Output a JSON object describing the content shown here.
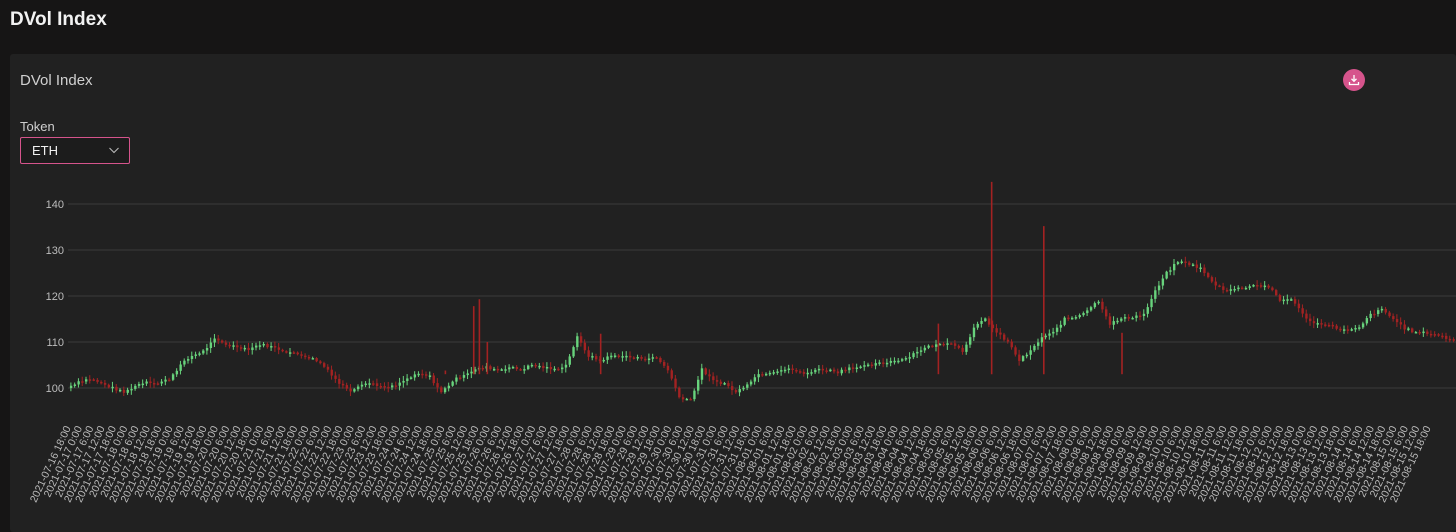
{
  "page": {
    "title": "DVol Index"
  },
  "card": {
    "title": "DVol Index"
  },
  "token": {
    "label": "Token",
    "value": "ETH"
  },
  "icons": {
    "download": "download-icon",
    "dropdown": "chevron-down-icon"
  },
  "colors": {
    "accent": "#d6548c",
    "up": "#68d37c",
    "down": "#a32222",
    "grid": "#3a3a3a",
    "text": "#bdbdbd"
  },
  "chart_data": {
    "type": "candlestick",
    "title": "",
    "ylim": [
      96,
      146
    ],
    "yticks": [
      100,
      110,
      120,
      130,
      140
    ],
    "grid": true,
    "x_ticks": [
      "2021-07-16 18:00",
      "2021-07-17 0:00",
      "2021-07-17 6:00",
      "2021-07-17 12:00",
      "2021-07-17 18:00",
      "2021-07-18 0:00",
      "2021-07-18 6:00",
      "2021-07-18 12:00",
      "2021-07-18 18:00",
      "2021-07-19 0:00",
      "2021-07-19 6:00",
      "2021-07-19 12:00",
      "2021-07-19 18:00",
      "2021-07-20 0:00",
      "2021-07-20 6:00",
      "2021-07-20 12:00",
      "2021-07-20 18:00",
      "2021-07-21 0:00",
      "2021-07-21 6:00",
      "2021-07-21 12:00",
      "2021-07-21 18:00",
      "2021-07-22 0:00",
      "2021-07-22 6:00",
      "2021-07-22 12:00",
      "2021-07-22 18:00",
      "2021-07-23 0:00",
      "2021-07-23 6:00",
      "2021-07-23 12:00",
      "2021-07-23 18:00",
      "2021-07-24 0:00",
      "2021-07-24 6:00",
      "2021-07-24 12:00",
      "2021-07-24 18:00",
      "2021-07-25 0:00",
      "2021-07-25 6:00",
      "2021-07-25 12:00",
      "2021-07-25 18:00",
      "2021-07-26 0:00",
      "2021-07-26 6:00",
      "2021-07-26 12:00",
      "2021-07-26 18:00",
      "2021-07-27 0:00",
      "2021-07-27 6:00",
      "2021-07-27 12:00",
      "2021-07-27 18:00",
      "2021-07-28 0:00",
      "2021-07-28 6:00",
      "2021-07-28 12:00",
      "2021-07-28 18:00",
      "2021-07-29 0:00",
      "2021-07-29 6:00",
      "2021-07-29 12:00",
      "2021-07-29 18:00",
      "2021-07-30 0:00",
      "2021-07-30 6:00",
      "2021-07-30 12:00",
      "2021-07-30 18:00",
      "2021-07-31 0:00",
      "2021-07-31 6:00",
      "2021-07-31 12:00",
      "2021-07-31 18:00",
      "2021-08-01 0:00",
      "2021-08-01 6:00",
      "2021-08-01 12:00",
      "2021-08-01 18:00",
      "2021-08-02 0:00",
      "2021-08-02 6:00",
      "2021-08-02 12:00",
      "2021-08-02 18:00",
      "2021-08-03 0:00",
      "2021-08-03 6:00",
      "2021-08-03 12:00",
      "2021-08-03 18:00",
      "2021-08-04 0:00",
      "2021-08-04 6:00",
      "2021-08-04 12:00",
      "2021-08-04 18:00",
      "2021-08-05 0:00",
      "2021-08-05 6:00",
      "2021-08-05 12:00",
      "2021-08-05 18:00",
      "2021-08-06 0:00",
      "2021-08-06 6:00",
      "2021-08-06 12:00",
      "2021-08-06 18:00",
      "2021-08-07 0:00",
      "2021-08-07 6:00",
      "2021-08-07 12:00",
      "2021-08-07 18:00",
      "2021-08-08 0:00",
      "2021-08-08 6:00",
      "2021-08-08 12:00",
      "2021-08-08 18:00",
      "2021-08-09 0:00",
      "2021-08-09 6:00",
      "2021-08-09 12:00",
      "2021-08-09 18:00",
      "2021-08-10 0:00",
      "2021-08-10 6:00",
      "2021-08-10 12:00",
      "2021-08-10 18:00",
      "2021-08-11 0:00",
      "2021-08-11 6:00",
      "2021-08-11 12:00",
      "2021-08-11 18:00",
      "2021-08-12 0:00",
      "2021-08-12 6:00",
      "2021-08-12 12:00",
      "2021-08-12 18:00",
      "2021-08-13 0:00",
      "2021-08-13 6:00",
      "2021-08-13 12:00",
      "2021-08-13 18:00",
      "2021-08-14 0:00",
      "2021-08-14 6:00",
      "2021-08-14 12:00",
      "2021-08-14 18:00",
      "2021-08-15 0:00",
      "2021-08-15 6:00",
      "2021-08-15 12:00",
      "2021-08-15 18:00"
    ],
    "close": [
      [
        0,
        100
      ],
      [
        1,
        101.5
      ],
      [
        2,
        102
      ],
      [
        3,
        101
      ],
      [
        4,
        100
      ],
      [
        5,
        99
      ],
      [
        6,
        100.5
      ],
      [
        7,
        101.5
      ],
      [
        8,
        101
      ],
      [
        9,
        102
      ],
      [
        10,
        105
      ],
      [
        11,
        107
      ],
      [
        12,
        108
      ],
      [
        13,
        110.5
      ],
      [
        14,
        109.5
      ],
      [
        15,
        109
      ],
      [
        16,
        108.5
      ],
      [
        17,
        109.5
      ],
      [
        18,
        109
      ],
      [
        19,
        108.2
      ],
      [
        20,
        107.5
      ],
      [
        21,
        107
      ],
      [
        22,
        106
      ],
      [
        23,
        104
      ],
      [
        24,
        101
      ],
      [
        25,
        99.5
      ],
      [
        26,
        101
      ],
      [
        27,
        101
      ],
      [
        28,
        100
      ],
      [
        29,
        100.5
      ],
      [
        30,
        102
      ],
      [
        31,
        103
      ],
      [
        32,
        102.5
      ],
      [
        33,
        99
      ],
      [
        34,
        101.5
      ],
      [
        35,
        103
      ],
      [
        36,
        104
      ],
      [
        37,
        104.5
      ],
      [
        38,
        104
      ],
      [
        39,
        104.5
      ],
      [
        40,
        104
      ],
      [
        41,
        105
      ],
      [
        42,
        104.5
      ],
      [
        43,
        104
      ],
      [
        44,
        105
      ],
      [
        45,
        111
      ],
      [
        46,
        107
      ],
      [
        47,
        106
      ],
      [
        48,
        107
      ],
      [
        49,
        107
      ],
      [
        50,
        106.5
      ],
      [
        51,
        106.5
      ],
      [
        52,
        106.5
      ],
      [
        53,
        104
      ],
      [
        54,
        98
      ],
      [
        55,
        97.5
      ],
      [
        56,
        104
      ],
      [
        57,
        101.5
      ],
      [
        58,
        101
      ],
      [
        59,
        99
      ],
      [
        60,
        101
      ],
      [
        61,
        103
      ],
      [
        62,
        103.5
      ],
      [
        63,
        104
      ],
      [
        64,
        104
      ],
      [
        65,
        103
      ],
      [
        66,
        104
      ],
      [
        67,
        104
      ],
      [
        68,
        103.5
      ],
      [
        69,
        104.5
      ],
      [
        70,
        104.5
      ],
      [
        71,
        105
      ],
      [
        72,
        105.5
      ],
      [
        73,
        106
      ],
      [
        74,
        106.5
      ],
      [
        75,
        108
      ],
      [
        76,
        109
      ],
      [
        77,
        109.5
      ],
      [
        78,
        110
      ],
      [
        79,
        108
      ],
      [
        80,
        113
      ],
      [
        81,
        115
      ],
      [
        82,
        112
      ],
      [
        83,
        110
      ],
      [
        84,
        106
      ],
      [
        85,
        108
      ],
      [
        86,
        111
      ],
      [
        87,
        112
      ],
      [
        88,
        115
      ],
      [
        89,
        115.5
      ],
      [
        90,
        117
      ],
      [
        91,
        119
      ],
      [
        92,
        114
      ],
      [
        93,
        115
      ],
      [
        94,
        115.5
      ],
      [
        95,
        116
      ],
      [
        96,
        121
      ],
      [
        97,
        125
      ],
      [
        98,
        127.5
      ],
      [
        99,
        127
      ],
      [
        100,
        126
      ],
      [
        101,
        123
      ],
      [
        102,
        121.5
      ],
      [
        103,
        121.5
      ],
      [
        104,
        122
      ],
      [
        105,
        122.5
      ],
      [
        106,
        122
      ],
      [
        107,
        119
      ],
      [
        108,
        119.5
      ],
      [
        109,
        116
      ],
      [
        110,
        114
      ],
      [
        111,
        114
      ],
      [
        112,
        113
      ],
      [
        113,
        112.5
      ],
      [
        114,
        113
      ],
      [
        115,
        116
      ],
      [
        116,
        117
      ],
      [
        117,
        115
      ],
      [
        118,
        113
      ],
      [
        119,
        112
      ],
      [
        120,
        112
      ],
      [
        121,
        111.5
      ],
      [
        122,
        110.5
      ],
      [
        123,
        110.5
      ],
      [
        124,
        110
      ]
    ],
    "spikes": [
      {
        "x": 33.3,
        "high": 103.8
      },
      {
        "x": 35.8,
        "high": 117.8
      },
      {
        "x": 36.3,
        "high": 119.3
      },
      {
        "x": 37.0,
        "high": 110.0
      },
      {
        "x": 47.0,
        "high": 111.8
      },
      {
        "x": 76.8,
        "high": 114.0
      },
      {
        "x": 81.5,
        "high": 144.8
      },
      {
        "x": 86.1,
        "high": 135.2
      },
      {
        "x": 93.0,
        "high": 112.0
      }
    ]
  }
}
